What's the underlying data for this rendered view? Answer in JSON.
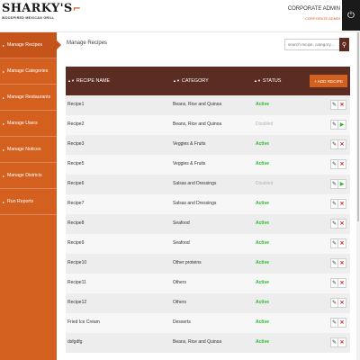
{
  "brand": {
    "name": "SHARKY'S",
    "tagline": "WOODFIRED MEXICAN GRILL"
  },
  "header": {
    "admin_title": "CORPORATE ADMIN",
    "admin_role": "CORPORATE ADMIN"
  },
  "sidebar": {
    "items": [
      {
        "label": "Manage Recipes"
      },
      {
        "label": "Manage Categories"
      },
      {
        "label": "Manage Restaurants"
      },
      {
        "label": "Manage Users"
      },
      {
        "label": "Manage Notices"
      },
      {
        "label": "Manage Districts"
      },
      {
        "label": "Run Reports"
      }
    ]
  },
  "main": {
    "title": "Manage Recipes",
    "search_placeholder": "search recipe, category..."
  },
  "table": {
    "headers": {
      "name": "RECIPE NAME",
      "category": "CATEGORY",
      "status": "STATUS"
    },
    "add_label": "+ ADD RECIPE",
    "rows": [
      {
        "name": "Recipe1",
        "category": "Beans, Rice and Quinoa",
        "status": "Active"
      },
      {
        "name": "Recipe2",
        "category": "Beans, Rice and Quinoa",
        "status": "Disabled"
      },
      {
        "name": "Recipe3",
        "category": "Veggies & Fruits",
        "status": "Active"
      },
      {
        "name": "Recipe5",
        "category": "Veggies & Fruits",
        "status": "Active"
      },
      {
        "name": "Recipe6",
        "category": "Salsas and Dressings",
        "status": "Disabled"
      },
      {
        "name": "Recipe7",
        "category": "Salsas and Dressings",
        "status": "Active"
      },
      {
        "name": "Recipe8",
        "category": "Seafood",
        "status": "Active"
      },
      {
        "name": "Recipe9",
        "category": "Seafood",
        "status": "Active"
      },
      {
        "name": "Recipe10",
        "category": "Other proteins",
        "status": "Active"
      },
      {
        "name": "Recipe11",
        "category": "Others",
        "status": "Active"
      },
      {
        "name": "Recipe12",
        "category": "Others",
        "status": "Active"
      },
      {
        "name": "Fried Ice Cream",
        "category": "Desserts",
        "status": "Active"
      },
      {
        "name": "dsfgdfg",
        "category": "Beans, Rice and Quinoa",
        "status": "Active"
      }
    ]
  },
  "icons": {
    "power": "power-icon",
    "search": "search-icon",
    "edit": "pencil-icon",
    "delete": "x-icon",
    "enable": "play-icon"
  },
  "colors": {
    "accent": "#d4601f",
    "header_bg": "#5a2c22",
    "active": "#2db82d",
    "disabled": "#b5b5b5",
    "delete": "#d62020"
  }
}
